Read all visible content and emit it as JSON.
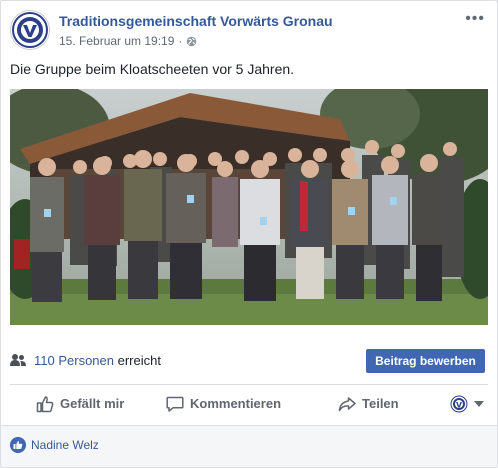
{
  "post": {
    "page_name": "Traditionsgemeinschaft Vorwärts Gronau",
    "date": "15. Februar um 19:19",
    "separator": "·",
    "privacy_icon": "globe-icon",
    "more_icon": "more-horizontal-icon",
    "caption": "Die Gruppe beim Kloatscheeten vor 5 Jahren."
  },
  "reach": {
    "icon": "people-icon",
    "count_text": "110 Personen",
    "suffix": " erreicht"
  },
  "promote_label": "Beitrag bewerben",
  "actions": {
    "like_label": "Gefällt mir",
    "comment_label": "Kommentieren",
    "share_label": "Teilen"
  },
  "footer": {
    "liker_name": "Nadine Welz"
  },
  "colors": {
    "link": "#365899",
    "button": "#4267b2",
    "text": "#1d2129",
    "muted": "#606770"
  }
}
